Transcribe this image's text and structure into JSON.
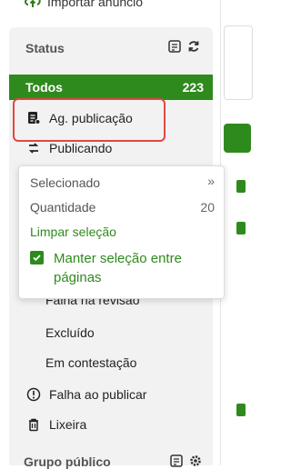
{
  "top": {
    "import_label": "Importar anúncio"
  },
  "panel": {
    "title": "Status",
    "items": [
      {
        "label": "Todos",
        "count": "223"
      },
      {
        "label": "Ag. publicação"
      },
      {
        "label": "Publicando"
      }
    ],
    "sub_items": [
      {
        "label": "Falha na revisão"
      },
      {
        "label": "Excluído"
      },
      {
        "label": "Em contestação"
      }
    ],
    "bottom_items": [
      {
        "label": "Falha ao publicar"
      },
      {
        "label": "Lixeira"
      }
    ],
    "group_title": "Grupo público"
  },
  "popover": {
    "selected_label": "Selecionado",
    "quantity_label": "Quantidade",
    "quantity_value": "20",
    "clear_label": "Limpar seleção",
    "keep_label": "Manter seleção entre páginas"
  },
  "colors": {
    "accent": "#2f8a1d",
    "highlight": "#e0483f"
  }
}
